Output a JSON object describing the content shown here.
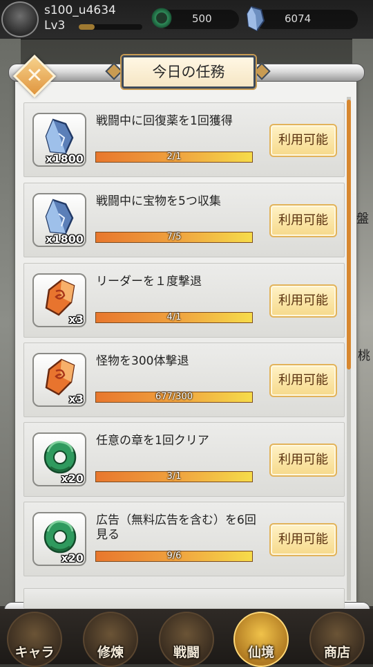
{
  "player": {
    "name": "s100_u4634",
    "level": "Lv3",
    "xp_fraction": 0.25
  },
  "resources": {
    "jade": "500",
    "crystal": "6074"
  },
  "dialog": {
    "title": "今日の任務",
    "close_symbol": "✕"
  },
  "side_labels": {
    "right_1": "盤",
    "right_2": "桃"
  },
  "tasks": [
    {
      "name": "戦闘中に回復薬を1回獲得",
      "progress": "2/1",
      "reward_icon": "crystal-icon",
      "reward_qty": "x1800",
      "button": "利用可能"
    },
    {
      "name": "戦闘中に宝物を5つ収集",
      "progress": "7/5",
      "reward_icon": "crystal-icon",
      "reward_qty": "x1800",
      "button": "利用可能"
    },
    {
      "name": "リーダーを１度撃退",
      "progress": "4/1",
      "reward_icon": "rune-stone-icon",
      "reward_qty": "x3",
      "button": "利用可能"
    },
    {
      "name": "怪物を300体撃退",
      "progress": "677/300",
      "reward_icon": "rune-stone-icon",
      "reward_qty": "x3",
      "button": "利用可能"
    },
    {
      "name": "任意の章を1回クリア",
      "progress": "3/1",
      "reward_icon": "jade-ring-icon",
      "reward_qty": "x20",
      "button": "利用可能"
    },
    {
      "name": "広告（無料広告を含む）を6回見る",
      "progress": "9/6",
      "reward_icon": "jade-ring-icon",
      "reward_qty": "x20",
      "button": "利用可能"
    }
  ],
  "nav": [
    {
      "label": "キャラ"
    },
    {
      "label": "修煉"
    },
    {
      "label": "戦闘"
    },
    {
      "label": "仙境",
      "active": true
    },
    {
      "label": "商店"
    }
  ],
  "colors": {
    "progress_start": "#e8772d",
    "progress_end": "#f6dc4a",
    "button_bg": "#f6d98a",
    "accent": "#d7872f"
  }
}
